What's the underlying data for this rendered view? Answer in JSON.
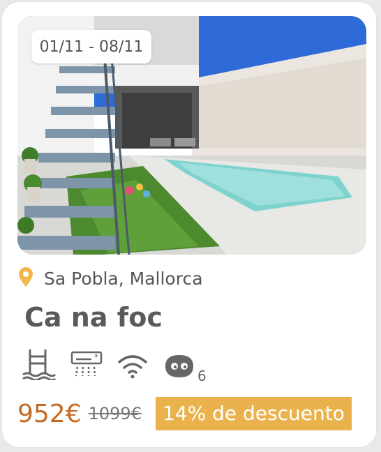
{
  "listing": {
    "dates": "01/11 - 08/11",
    "location": "Sa Pobla, Mallorca",
    "name": "Ca na foc",
    "guests": "6",
    "price": "952€",
    "old_price": "1099€",
    "discount": "14% de descuento"
  },
  "icons": {
    "location": "map-pin-icon",
    "pool": "pool-ladder-icon",
    "ac": "air-conditioner-icon",
    "wifi": "wifi-icon",
    "guests": "guests-icon"
  },
  "colors": {
    "accent": "#f2b64a",
    "price": "#c56a23",
    "badge": "#eab24d"
  }
}
